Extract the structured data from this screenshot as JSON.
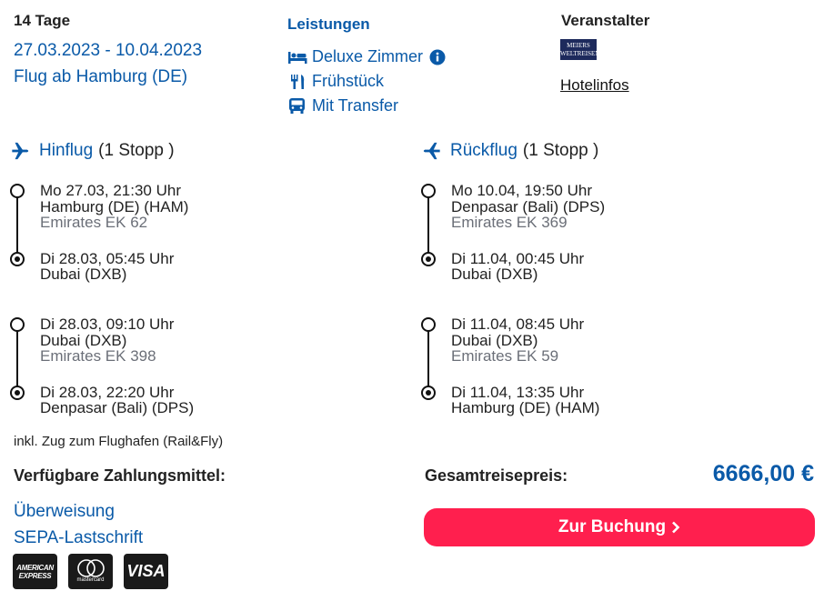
{
  "trip": {
    "duration": "14 Tage",
    "dates": "27.03.2023 - 10.04.2023",
    "departure": "Flug ab Hamburg (DE)"
  },
  "services": {
    "heading": "Leistungen",
    "items": [
      {
        "label": "Deluxe Zimmer",
        "icon": "bed-icon"
      },
      {
        "label": "Frühstück",
        "icon": "cutlery-icon"
      },
      {
        "label": "Mit Transfer",
        "icon": "bus-icon"
      }
    ]
  },
  "organizer": {
    "heading": "Veranstalter",
    "logo_text": "MEIERS WELTREISEN",
    "hotel_link": "Hotelinfos"
  },
  "outbound": {
    "title": "Hinflug",
    "stops": "(1 Stopp )",
    "legs": [
      {
        "dep_time": "Mo 27.03, 21:30 Uhr",
        "dep_airport": "Hamburg (DE) (HAM)",
        "flight": "Emirates EK 62",
        "arr_time": "Di 28.03, 05:45 Uhr",
        "arr_airport": "Dubai (DXB)"
      },
      {
        "dep_time": "Di 28.03, 09:10 Uhr",
        "dep_airport": "Dubai (DXB)",
        "flight": "Emirates EK 398",
        "arr_time": "Di 28.03, 22:20 Uhr",
        "arr_airport": "Denpasar (Bali) (DPS)"
      }
    ]
  },
  "return": {
    "title": "Rückflug",
    "stops": "(1 Stopp )",
    "legs": [
      {
        "dep_time": "Mo 10.04, 19:50 Uhr",
        "dep_airport": "Denpasar (Bali) (DPS)",
        "flight": "Emirates EK 369",
        "arr_time": "Di 11.04, 00:45 Uhr",
        "arr_airport": "Dubai (DXB)"
      },
      {
        "dep_time": "Di 11.04, 08:45 Uhr",
        "dep_airport": "Dubai (DXB)",
        "flight": "Emirates EK 59",
        "arr_time": "Di 11.04, 13:35 Uhr",
        "arr_airport": "Hamburg (DE) (HAM)"
      }
    ]
  },
  "rail_note": "inkl. Zug zum Flughafen (Rail&Fly)",
  "payment": {
    "heading": "Verfügbare Zahlungsmittel:",
    "methods": [
      "Überweisung",
      "SEPA-Lastschrift"
    ],
    "cards": [
      "AMERICAN EXPRESS",
      "mastercard",
      "VISA"
    ]
  },
  "price": {
    "label": "Gesamtreisepreis:",
    "value": "6666,00 €"
  },
  "booking": {
    "button_label": "Zur Buchung"
  },
  "colors": {
    "accent_blue": "#0a5aa8",
    "button_red": "#ff1f4e"
  }
}
